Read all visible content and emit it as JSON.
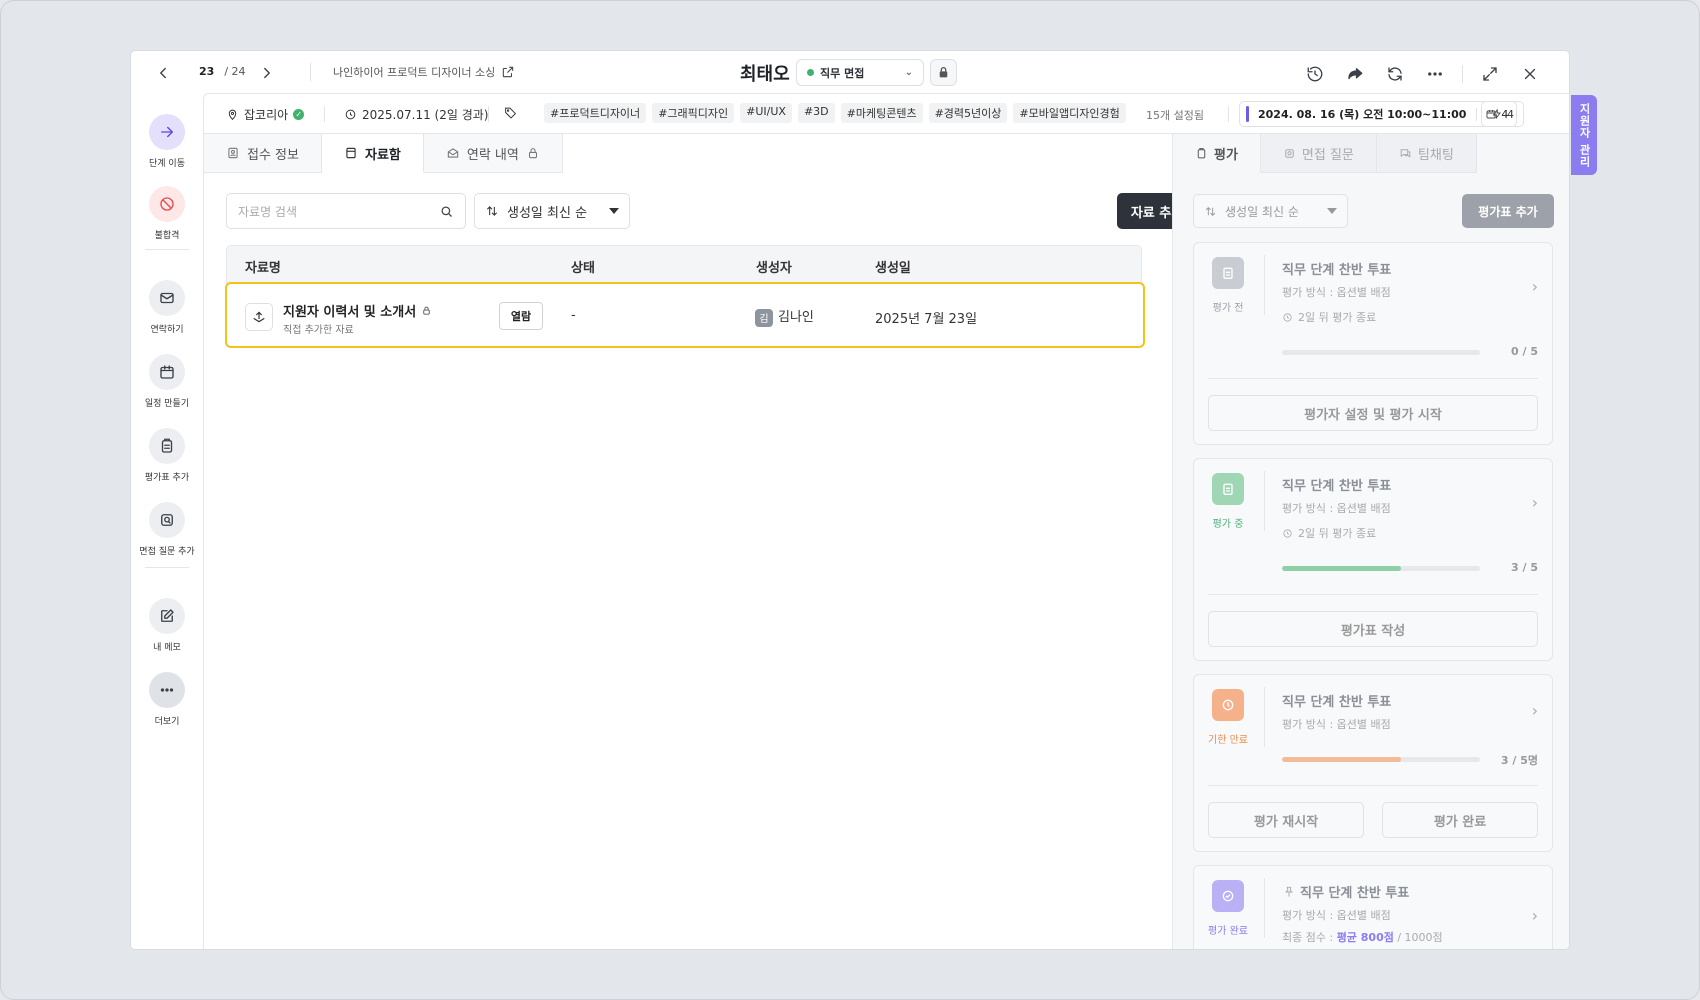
{
  "header": {
    "pager_current": "23",
    "pager_total": "/ 24",
    "sourcing_label": "나인하이어 프로덕트 디자이너 소싱",
    "candidate_name": "최태오",
    "stage_label": "직무 면접",
    "stage_dot_color": "#3fb26d"
  },
  "rail": {
    "items": [
      {
        "label": "단계 이동",
        "icon": "arrow-right-icon"
      },
      {
        "label": "불합격",
        "icon": "block-icon"
      },
      {
        "label": "연락하기",
        "icon": "mail-icon"
      },
      {
        "label": "일정 만들기",
        "icon": "calendar-icon"
      },
      {
        "label": "평가표 추가",
        "icon": "clipboard-icon"
      },
      {
        "label": "면접 질문 추가",
        "icon": "question-icon"
      },
      {
        "label": "내 메모",
        "icon": "edit-icon"
      },
      {
        "label": "더보기",
        "icon": "more-icon"
      }
    ]
  },
  "info": {
    "source": "잡코리아",
    "date": "2025.07.11 (2일 경과)",
    "tags": [
      "#프로덕트디자이너",
      "#그래픽디자인",
      "#UI/UX",
      "#3D",
      "#마케팅콘텐츠",
      "#경력5년이상",
      "#모바일앱디자인경험"
    ],
    "tag_count": "15개 설정됨",
    "schedule": "2024. 08. 16 (목) 오전 10:00~11:00",
    "schedule_count": "4",
    "bolt_count": "4",
    "side_tab": "지원자 관리",
    "accent_color": "#6e5ce6"
  },
  "tabs": [
    {
      "label": "접수 정보"
    },
    {
      "label": "자료함"
    },
    {
      "label": "연락 내역"
    }
  ],
  "docs": {
    "search_placeholder": "자료명 검색",
    "sort_label": "생성일 최신 순",
    "add_label": "자료 추가",
    "columns": [
      "자료명",
      "상태",
      "생성자",
      "생성일"
    ],
    "rows": [
      {
        "title": "지원자 이력서 및 소개서",
        "subtitle": "직접 추가한 자료",
        "view_label": "열람",
        "status": "-",
        "creator_initial": "김",
        "creator": "김나인",
        "created": "2025년 7월 23일"
      }
    ],
    "highlight_color": "#f2c318"
  },
  "right_panel": {
    "tabs": [
      "평가",
      "면접 질문",
      "팀채팅"
    ],
    "sort_label": "생성일 최신 순",
    "add_label": "평가표 추가",
    "cards": [
      {
        "status": "평가 전",
        "status_color": "#9aa0a8",
        "badge_color": "#c9cdd3",
        "title": "직무 단계 찬반 투표",
        "meta": "평가 방식 : 옵션별 배점",
        "due": "2일 뒤 평가 종료",
        "progress_label": "0 / 5",
        "progress_fraction": 0,
        "progress_color": "#9aa0a8",
        "buttons": [
          "평가자 설정 및 평가 시작"
        ]
      },
      {
        "status": "평가 중",
        "status_color": "#4cb07a",
        "badge_color": "#9fd6b4",
        "title": "직무 단계 찬반 투표",
        "meta": "평가 방식 : 옵션별 배점",
        "due": "2일 뒤 평가 종료",
        "progress_label": "3 / 5",
        "progress_fraction": 0.6,
        "progress_color": "#8fcfa8",
        "buttons": [
          "평가표 작성"
        ]
      },
      {
        "status": "기한 만료",
        "status_color": "#ef8a4a",
        "badge_color": "#f5b28a",
        "title": "직무 단계 찬반 투표",
        "meta": "평가 방식 : 옵션별 배점",
        "progress_label": "3 / 5명",
        "progress_fraction": 0.6,
        "progress_color": "#f2bc99",
        "buttons": [
          "평가 재시작",
          "평가 완료"
        ]
      },
      {
        "status": "평가 완료",
        "status_color": "#8b7cf0",
        "badge_color": "#b9b0f5",
        "title": "직무 단계 찬반 투표",
        "meta": "평가 방식 : 옵션별 배점",
        "score_prefix": "최종 점수 : ",
        "score_value": "평균 800점",
        "score_suffix": " / 1000점"
      }
    ]
  }
}
